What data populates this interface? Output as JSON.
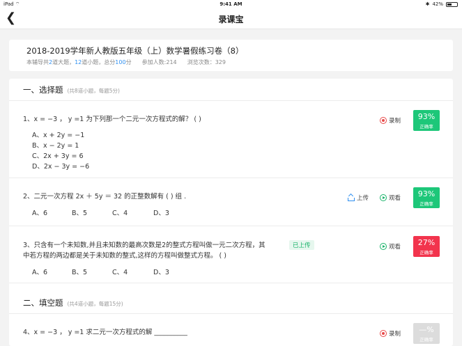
{
  "status": {
    "device": "iPad",
    "wifi": "wifi-icon",
    "time": "9:41 AM",
    "battery": "42%"
  },
  "nav": {
    "title": "录课宝"
  },
  "paper": {
    "title": "2018-2019学年新人教版五年级（上）数学暑假练习卷（8）",
    "meta_prefix": "本辅导共",
    "big_count": "2",
    "big_unit": "道大题，",
    "small_count": "12",
    "small_unit": "道小题，总分",
    "score": "100",
    "score_unit": "分",
    "participants": "参加人数:214",
    "views": "浏览次数：329"
  },
  "sections": [
    {
      "name": "一、选择题",
      "note": "(共8道小题，每题5分)"
    },
    {
      "name": "二、填空题",
      "note": "(共4道小题，每题15分)"
    }
  ],
  "questions": [
    {
      "stem": "1、x = −3 ， y =1  为下列那一个二元一次方程式的解？ (      )",
      "options": [
        "A、x + 2y = −1",
        "B、x − 2y = 1",
        "C、2x + 3y = 6",
        "D、2x − 3y = −6"
      ],
      "actions": [
        "录制"
      ],
      "rate": "93%",
      "rate_label": "正确率"
    },
    {
      "stem": "2、二元一次方程 2x ＋ 5y ＝ 32 的正整数解有  (      ) 组 .",
      "options": [
        "A、6",
        "B、5",
        "C、4",
        "D、3"
      ],
      "actions": [
        "上传",
        "观看"
      ],
      "rate": "93%",
      "rate_label": "正确率"
    },
    {
      "stem_line1": "3、只含有一个未知数,并且未知数的最高次数是2的整式方程叫做一元二次方程，其",
      "stem_line2": "中若方程的两边都是关于未知数的整式,这样的方程叫做整式方程。 (      )",
      "tag": "已上传",
      "options": [
        "A、6",
        "B、5",
        "C、4",
        "D、3"
      ],
      "actions": [
        "观看"
      ],
      "rate": "27%",
      "rate_label": "正确率"
    },
    {
      "stem": "4、x = −3 ， y =1  求二元一次方程式的解 __________",
      "actions": [
        "录制"
      ],
      "rate": "—%",
      "rate_label": "正确率"
    }
  ],
  "colors": {
    "green": "#1dc779",
    "red": "#f2344d",
    "gray": "#dcdcdc",
    "blue": "#2e8ff0"
  }
}
